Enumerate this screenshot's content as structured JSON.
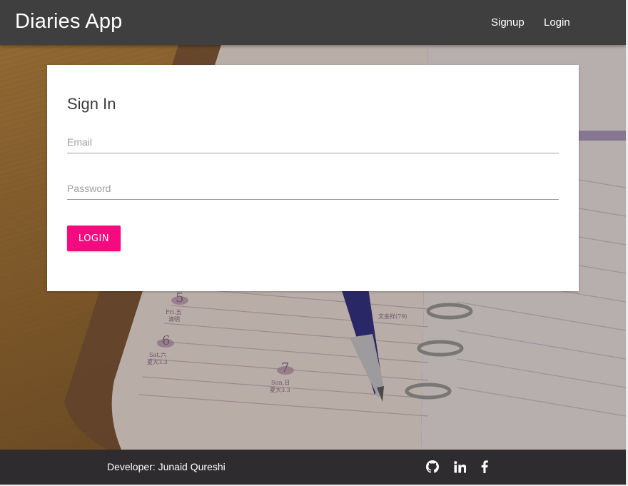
{
  "navbar": {
    "brand": "Diaries App",
    "links": [
      {
        "label": "Signup"
      },
      {
        "label": "Login"
      }
    ]
  },
  "hero": {
    "diary_marks": [
      "5",
      "6",
      "7",
      "Fri.五",
      "清明",
      "Sat.六",
      "夏大3.3",
      "Sun.日",
      "夏大3.3",
      "文金祥(79)"
    ]
  },
  "signin": {
    "title": "Sign In",
    "email": {
      "placeholder": "Email",
      "value": ""
    },
    "password": {
      "placeholder": "Password",
      "value": ""
    },
    "button_label": "LOGIN"
  },
  "footer": {
    "developer_text": "Developer: Junaid Qureshi",
    "icons": [
      "github-icon",
      "linkedin-icon",
      "facebook-icon"
    ]
  },
  "colors": {
    "navbar_bg": "#3f3f3f",
    "footer_bg": "#2e2c2e",
    "accent": "#f50a7f",
    "card_bg": "#ffffff"
  }
}
